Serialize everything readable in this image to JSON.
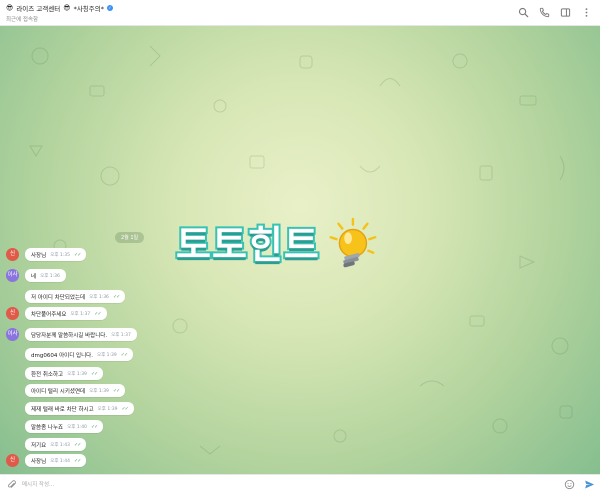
{
  "header": {
    "title": "라이즈 고객센터",
    "title_suffix": "*사칭주의*",
    "last_seen": "최근에 접속함",
    "title_emoji": "😎",
    "verified_icon": "verified-badge-icon"
  },
  "header_actions": [
    {
      "name": "search-icon"
    },
    {
      "name": "phone-icon"
    },
    {
      "name": "sidebar-icon"
    },
    {
      "name": "more-icon"
    }
  ],
  "watermark": {
    "text": "토토힌트",
    "colors": {
      "stroke": "#37c2b4",
      "fill": "#ffffff",
      "bulb": "#f5c21b"
    }
  },
  "date_separator": "2월 1일",
  "avatars": [
    {
      "letter": "신",
      "color": "#e05a4a"
    },
    {
      "letter": "이사",
      "color": "#8a74dd"
    },
    {
      "letter": "신",
      "color": "#e05a4a"
    },
    {
      "letter": "이사",
      "color": "#8a74dd"
    },
    {
      "letter": "신",
      "color": "#e05a4a"
    }
  ],
  "messages": [
    {
      "text": "사장님",
      "time": "오후 1:35",
      "ticks": "✓✓"
    },
    {
      "text": "네",
      "time": "오후 1:36",
      "ticks": ""
    },
    {
      "text": "저 아이디 차단되었는데",
      "time": "오후 1:36",
      "ticks": "✓✓"
    },
    {
      "text": "차단풀어주세요",
      "time": "오후 1:37",
      "ticks": "✓✓"
    },
    {
      "text": "담당자분께 말씀하시길 바랍니다.",
      "time": "오후 1:37",
      "ticks": ""
    },
    {
      "text": "dmg0604 아이디 입니다.",
      "time": "오후 1:39",
      "ticks": "✓✓"
    },
    {
      "text": "환전 취소하고",
      "time": "오후 1:39",
      "ticks": "✓✓"
    },
    {
      "text": "아이디 털리 시키셨연데",
      "time": "오후 1:39",
      "ticks": "✓✓"
    },
    {
      "text": "제재 털래 바로 차단 하시고",
      "time": "오후 1:39",
      "ticks": "✓✓"
    },
    {
      "text": "말씀좀 나누죠",
      "time": "오후 1:40",
      "ticks": "✓✓"
    },
    {
      "text": "저기요",
      "time": "오후 1:43",
      "ticks": "✓✓"
    },
    {
      "text": "사장님",
      "time": "오후 1:44",
      "ticks": "✓✓"
    }
  ],
  "composer": {
    "placeholder": "메시지 작성..."
  }
}
